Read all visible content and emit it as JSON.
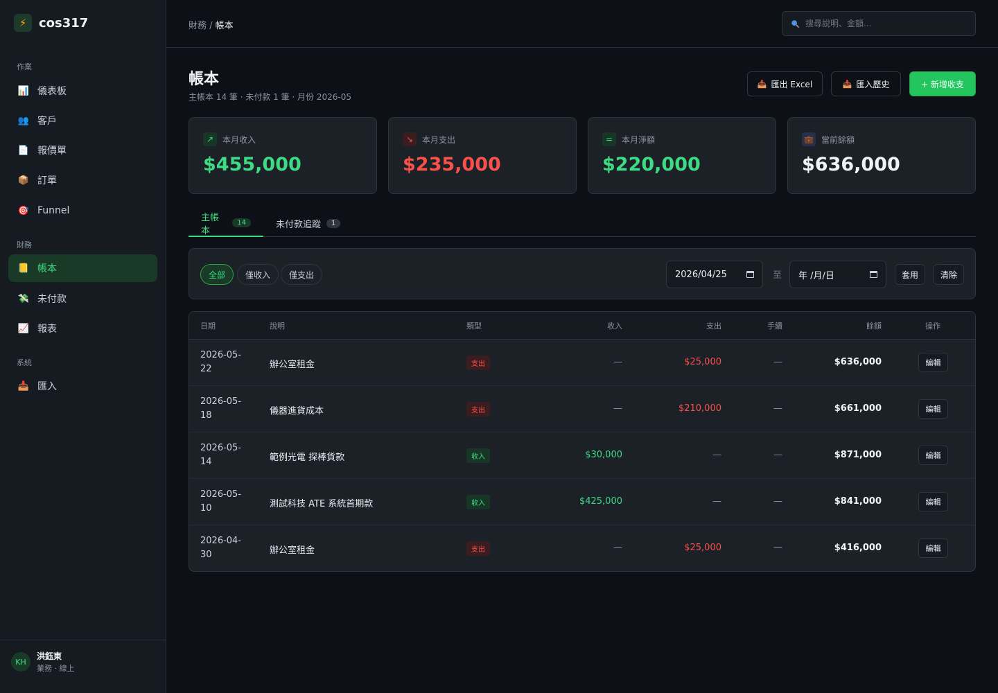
{
  "brand": {
    "name": "cos317",
    "logo_icon": "⚡"
  },
  "nav": {
    "section_ops": "作業",
    "section_finance": "財務",
    "section_system": "系統",
    "items": [
      {
        "label": "儀表板",
        "icon": "📊"
      },
      {
        "label": "客戶",
        "icon": "👥"
      },
      {
        "label": "報價單",
        "icon": "📄"
      },
      {
        "label": "訂單",
        "icon": "📦"
      },
      {
        "label": "Funnel",
        "icon": "🎯"
      },
      {
        "label": "帳本",
        "icon": "📒"
      },
      {
        "label": "未付款",
        "icon": "💸"
      },
      {
        "label": "報表",
        "icon": "📈"
      },
      {
        "label": "匯入",
        "icon": "📥"
      }
    ]
  },
  "user": {
    "initials": "KH",
    "name": "洪鈺東",
    "status": "業務 · 線上"
  },
  "breadcrumb": {
    "parent": "財務",
    "separator": " / ",
    "current": "帳本"
  },
  "search": {
    "placeholder": "搜尋說明、金額..."
  },
  "page": {
    "title": "帳本",
    "subtitle": "主帳本 14 筆 · 未付款 1 筆 · 月份 2026-05"
  },
  "actions": {
    "export_label": "匯出 Excel",
    "history_label": "匯入歷史",
    "add_label": "+ 新增收支"
  },
  "stats": [
    {
      "label": "本月收入",
      "value": "$455,000",
      "icon": "↗",
      "color": "#3ddc84"
    },
    {
      "label": "本月支出",
      "value": "$235,000",
      "icon": "↘",
      "color": "#f85149"
    },
    {
      "label": "本月淨額",
      "value": "$220,000",
      "icon": "=",
      "color": "#3ddc84"
    },
    {
      "label": "當前餘額",
      "value": "$636,000",
      "icon": "💼",
      "color": "#f0f3f6"
    }
  ],
  "tabs": [
    {
      "label": "主帳本",
      "count": "14"
    },
    {
      "label": "未付款追蹤",
      "count": "1"
    }
  ],
  "filter": {
    "chips": [
      "全部",
      "僅收入",
      "僅支出"
    ],
    "date_from": "2026/04/25",
    "date_to_placeholder": "年 /月/日",
    "to_label": "至",
    "apply_label": "套用",
    "clear_label": "清除"
  },
  "table": {
    "headers": {
      "date": "日期",
      "desc": "說明",
      "type": "類型",
      "income": "收入",
      "expense": "支出",
      "fee": "手續",
      "balance": "餘額",
      "action": "操作"
    },
    "edit_label": "編輯",
    "rows": [
      {
        "date": "2026-05-22",
        "desc": "辦公室租金",
        "type": "支出",
        "income": "—",
        "expense": "$25,000",
        "fee": "—",
        "balance": "$636,000"
      },
      {
        "date": "2026-05-18",
        "desc": "儀器進貨成本",
        "type": "支出",
        "income": "—",
        "expense": "$210,000",
        "fee": "—",
        "balance": "$661,000"
      },
      {
        "date": "2026-05-14",
        "desc": "範例光電 探棒貨款",
        "type": "收入",
        "income": "$30,000",
        "expense": "—",
        "fee": "—",
        "balance": "$871,000"
      },
      {
        "date": "2026-05-10",
        "desc": "測試科技 ATE 系統首期款",
        "type": "收入",
        "income": "$425,000",
        "expense": "—",
        "fee": "—",
        "balance": "$841,000"
      },
      {
        "date": "2026-04-30",
        "desc": "辦公室租金",
        "type": "支出",
        "income": "—",
        "expense": "$25,000",
        "fee": "—",
        "balance": "$416,000"
      }
    ]
  }
}
